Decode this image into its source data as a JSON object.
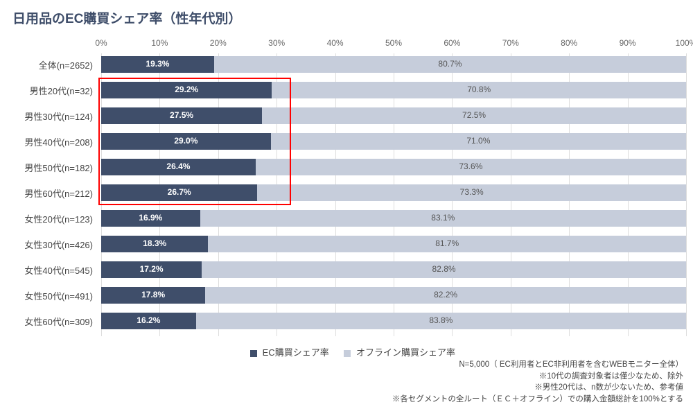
{
  "title": "日用品のEC購買シェア率（性年代別）",
  "legend": {
    "ec": "EC購買シェア率",
    "off": "オフライン購買シェア率"
  },
  "notes": [
    "N=5,000（ EC利用者とEC非利用者を含むWEBモニター全体）",
    "※10代の調査対象者は僅少なため、除外",
    "※男性20代は、n数が少ないため、参考値",
    "※各セグメントの全ルート（ＥＣ＋オフライン）での購入金額総計を100%とする"
  ],
  "chart_data": {
    "type": "bar",
    "orientation": "horizontal",
    "stacked": true,
    "xlabel": "",
    "ylabel": "",
    "xlim": [
      0,
      100
    ],
    "ticks": [
      0,
      10,
      20,
      30,
      40,
      50,
      60,
      70,
      80,
      90,
      100
    ],
    "categories": [
      "全体(n=2652)",
      "男性20代(n=32)",
      "男性30代(n=124)",
      "男性40代(n=208)",
      "男性50代(n=182)",
      "男性60代(n=212)",
      "女性20代(n=123)",
      "女性30代(n=426)",
      "女性40代(n=545)",
      "女性50代(n=491)",
      "女性60代(n=309)"
    ],
    "series": [
      {
        "name": "EC購買シェア率",
        "color": "#3f4e6a",
        "values": [
          19.3,
          29.2,
          27.5,
          29.0,
          26.4,
          26.7,
          16.9,
          18.3,
          17.2,
          17.8,
          16.2
        ]
      },
      {
        "name": "オフライン購買シェア率",
        "color": "#c6cddb",
        "values": [
          80.7,
          70.8,
          72.5,
          71.0,
          73.6,
          73.3,
          83.1,
          81.7,
          82.8,
          82.2,
          83.8
        ]
      }
    ],
    "highlight_rows": [
      1,
      2,
      3,
      4,
      5
    ]
  }
}
